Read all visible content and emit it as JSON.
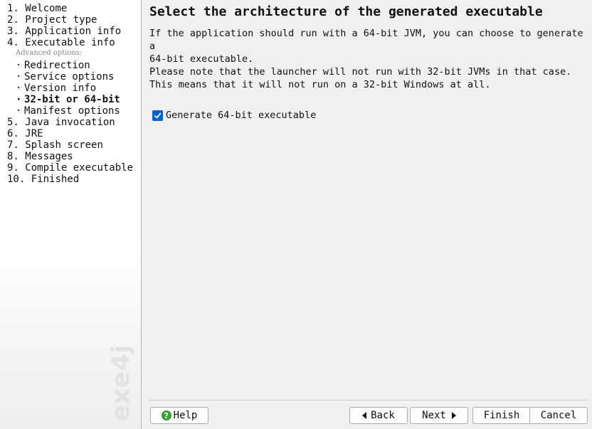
{
  "sidebar": {
    "steps_top": [
      {
        "num": "1.",
        "label": "Welcome"
      },
      {
        "num": "2.",
        "label": "Project type"
      },
      {
        "num": "3.",
        "label": "Application info"
      },
      {
        "num": "4.",
        "label": "Executable info"
      }
    ],
    "advanced_label": "Advanced options:",
    "sub_steps": [
      {
        "label": "Redirection"
      },
      {
        "label": "Service options"
      },
      {
        "label": "Version info"
      },
      {
        "label": "32-bit or 64-bit"
      },
      {
        "label": "Manifest options"
      }
    ],
    "bullet": "·",
    "steps_bottom": [
      {
        "num": "5.",
        "label": "Java invocation"
      },
      {
        "num": "6.",
        "label": "JRE"
      },
      {
        "num": "7.",
        "label": "Splash screen"
      },
      {
        "num": "8.",
        "label": "Messages"
      },
      {
        "num": "9.",
        "label": "Compile executable"
      },
      {
        "num": "10.",
        "label": "Finished"
      }
    ],
    "watermark": "exe4j"
  },
  "main": {
    "title": "Select the architecture of the generated executable",
    "paragraph1": "If the application should run with a 64-bit JVM, you can choose to generate a\n64-bit executable.",
    "paragraph2": "Please note that the launcher will not run with 32-bit JVMs in that case.\nThis means that it will not run on a 32-bit Windows at all.",
    "checkbox": {
      "label": "Generate 64-bit executable",
      "checked": true
    }
  },
  "buttons": {
    "help": "Help",
    "back": "Back",
    "next": "Next",
    "finish": "Finish",
    "cancel": "Cancel"
  },
  "colors": {
    "checkbox": "#0a5fc8",
    "help_icon": "#3a9d3a"
  },
  "icons": {
    "help": "help-circle-icon",
    "back": "triangle-left-icon",
    "next": "triangle-right-icon",
    "check": "checkmark-icon"
  }
}
